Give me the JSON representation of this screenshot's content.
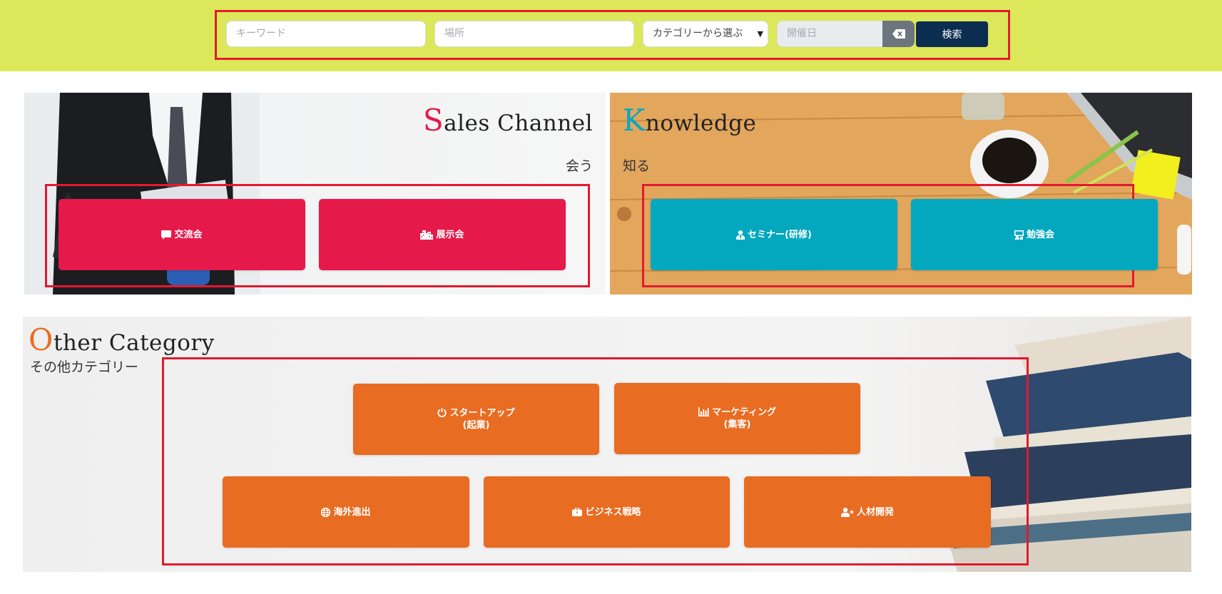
{
  "search": {
    "keyword_placeholder": "キーワード",
    "location_placeholder": "場所",
    "category_selected": "カテゴリーから選ぶ",
    "date_placeholder": "開催日",
    "clear_icon": "backspace-icon",
    "submit_label": "検索"
  },
  "sales": {
    "title_cap": "S",
    "title_rest": "ales Channel",
    "subtitle": "会う",
    "accent": "#e5194a",
    "buttons": [
      {
        "label": "交流会",
        "icon": "comment-icon"
      },
      {
        "label": "展示会",
        "icon": "building-icon"
      }
    ]
  },
  "knowledge": {
    "title_cap": "K",
    "title_rest": "nowledge",
    "subtitle": "知る",
    "accent": "#03a8bf",
    "buttons": [
      {
        "label": "セミナー(研修)",
        "icon": "user-tie-icon"
      },
      {
        "label": "勉強会",
        "icon": "chalkboard-teacher-icon"
      }
    ]
  },
  "other": {
    "title_cap": "O",
    "title_rest": "ther Category",
    "subtitle": "その他カテゴリー",
    "accent": "#e86c22",
    "buttons": [
      {
        "line1": "スタートアップ",
        "line2": "(起業)",
        "icon": "power-icon"
      },
      {
        "line1": "マーケティング",
        "line2": "(集客)",
        "icon": "chart-bar-icon"
      },
      {
        "label": "海外進出",
        "icon": "globe-icon"
      },
      {
        "label": "ビジネス戦略",
        "icon": "briefcase-icon"
      },
      {
        "label": "人材開発",
        "icon": "user-plus-icon"
      }
    ]
  }
}
